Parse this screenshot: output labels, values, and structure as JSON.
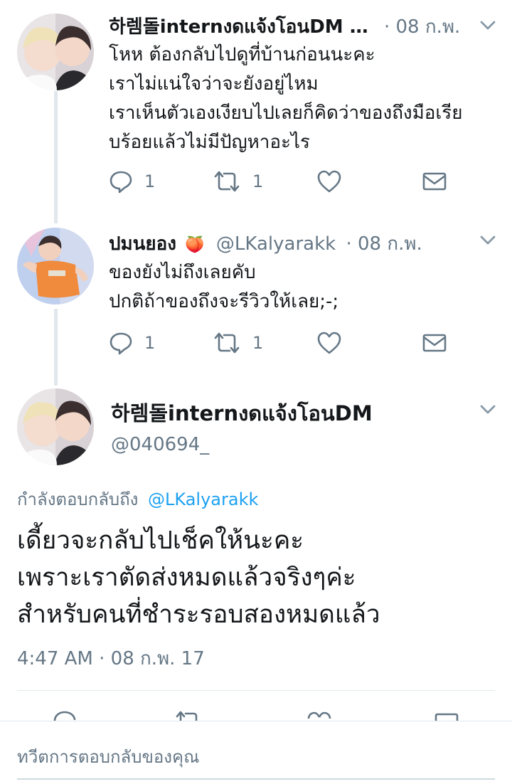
{
  "tweets": [
    {
      "name": "하렘돌internงดแจ้งโอนDM …",
      "dot": "·",
      "date": "08 ก.พ.",
      "lines": [
        "โหห ต้องกลับไปดูที่บ้านก่อนนะคะ",
        "เราไม่แน่ใจว่าจะยังอยู่ไหม",
        "เราเห็นตัวเองเงียบไปเลยก็คิดว่าของถึงมือเรีย",
        "บร้อยแล้วไม่มีปัญหาอะไร"
      ],
      "reply_count": "1",
      "retweet_count": "1"
    },
    {
      "name": "ปมนยอง",
      "emoji": "🍑",
      "handle": "@LKalyarakk",
      "dot": "·",
      "date": "08 ก.พ.",
      "lines": [
        "ของยังไม่ถึงเลยคับ",
        "ปกติถ้าของถึงจะรีวิวให้เลย;-;"
      ],
      "reply_count": "1",
      "retweet_count": "1"
    }
  ],
  "focus": {
    "name": "하렘돌internงดแจ้งโอนDM",
    "handle": "@040694_",
    "replying_prefix": "กำลังตอบกลับถึง",
    "replying_handle": "@LKalyarakk",
    "lines": [
      "เดี้ยวจะกลับไปเช็คให้นะคะ",
      "เพราะเราตัดส่งหมดแล้วจริงๆค่ะ",
      "สำหรับคนที่ชำระรอบสองหมดแล้ว"
    ],
    "timestamp": "4:47 AM · 08 ก.พ. 17"
  },
  "reply_placeholder": "ทวีตการตอบกลับของคุณ",
  "colors": {
    "gray": "#657786",
    "link": "#1da1f2",
    "line": "#e1e8ed"
  }
}
